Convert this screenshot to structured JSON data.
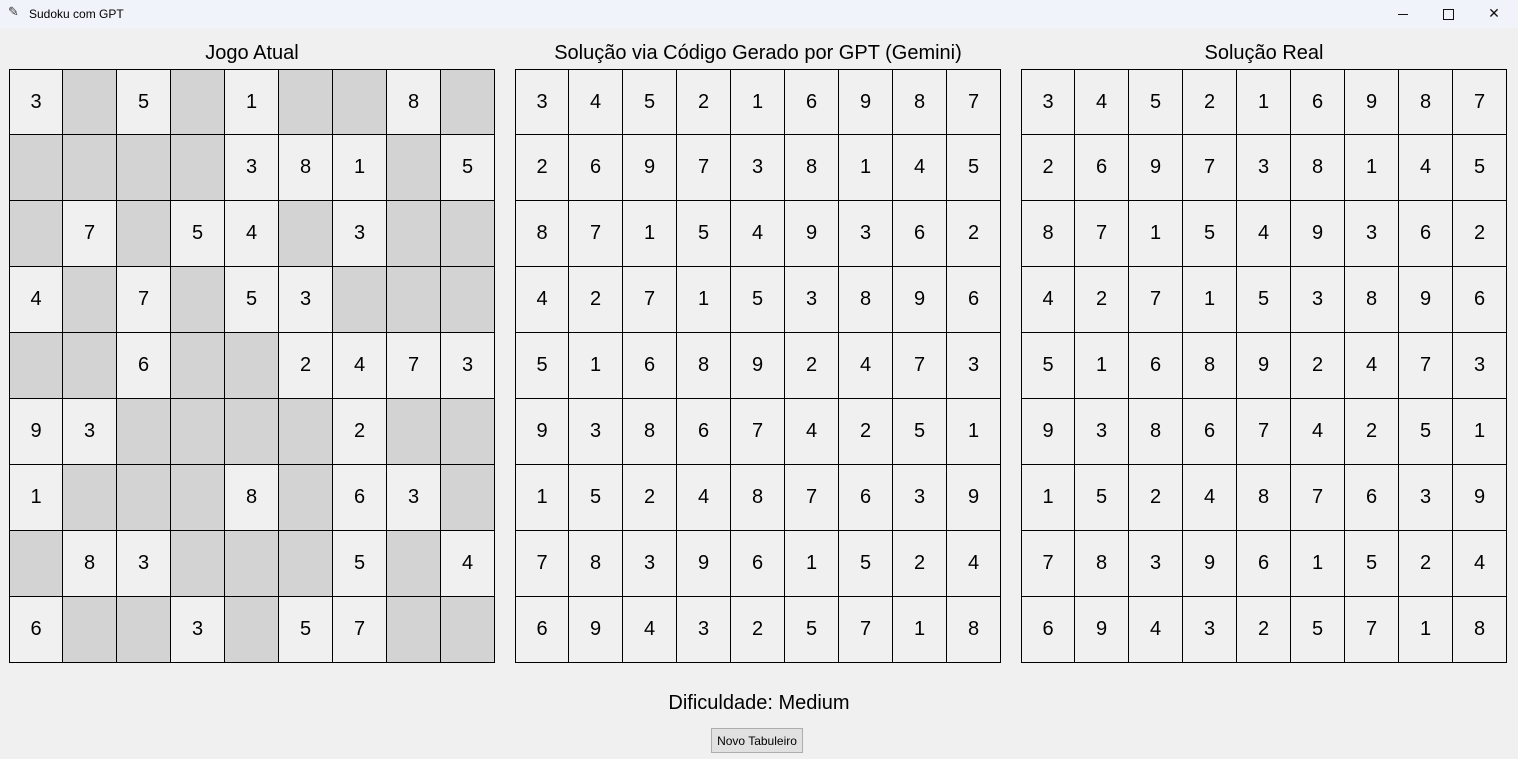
{
  "window": {
    "title": "Sudoku com GPT",
    "app_icon": "feather-icon",
    "minimize_glyph": "—",
    "maximize_glyph": "☐",
    "close_glyph": "✕"
  },
  "panels": [
    {
      "title": "Jogo Atual",
      "rows": [
        [
          "3",
          "",
          "5",
          "",
          "1",
          "",
          "",
          "8",
          ""
        ],
        [
          "",
          "",
          "",
          "",
          "3",
          "8",
          "1",
          "",
          "5"
        ],
        [
          "",
          "7",
          "",
          "5",
          "4",
          "",
          "3",
          "",
          ""
        ],
        [
          "4",
          "",
          "7",
          "",
          "5",
          "3",
          "",
          "",
          ""
        ],
        [
          "",
          "",
          "6",
          "",
          "",
          "2",
          "4",
          "7",
          "3"
        ],
        [
          "9",
          "3",
          "",
          "",
          "",
          "",
          "2",
          "",
          ""
        ],
        [
          "1",
          "",
          "",
          "",
          "8",
          "",
          "6",
          "3",
          ""
        ],
        [
          "",
          "8",
          "3",
          "",
          "",
          "",
          "5",
          "",
          "4"
        ],
        [
          "6",
          "",
          "",
          "3",
          "",
          "5",
          "7",
          "",
          ""
        ]
      ]
    },
    {
      "title": "Solução via Código Gerado por GPT (Gemini)",
      "rows": [
        [
          "3",
          "4",
          "5",
          "2",
          "1",
          "6",
          "9",
          "8",
          "7"
        ],
        [
          "2",
          "6",
          "9",
          "7",
          "3",
          "8",
          "1",
          "4",
          "5"
        ],
        [
          "8",
          "7",
          "1",
          "5",
          "4",
          "9",
          "3",
          "6",
          "2"
        ],
        [
          "4",
          "2",
          "7",
          "1",
          "5",
          "3",
          "8",
          "9",
          "6"
        ],
        [
          "5",
          "1",
          "6",
          "8",
          "9",
          "2",
          "4",
          "7",
          "3"
        ],
        [
          "9",
          "3",
          "8",
          "6",
          "7",
          "4",
          "2",
          "5",
          "1"
        ],
        [
          "1",
          "5",
          "2",
          "4",
          "8",
          "7",
          "6",
          "3",
          "9"
        ],
        [
          "7",
          "8",
          "3",
          "9",
          "6",
          "1",
          "5",
          "2",
          "4"
        ],
        [
          "6",
          "9",
          "4",
          "3",
          "2",
          "5",
          "7",
          "1",
          "8"
        ]
      ]
    },
    {
      "title": "Solução Real",
      "rows": [
        [
          "3",
          "4",
          "5",
          "2",
          "1",
          "6",
          "9",
          "8",
          "7"
        ],
        [
          "2",
          "6",
          "9",
          "7",
          "3",
          "8",
          "1",
          "4",
          "5"
        ],
        [
          "8",
          "7",
          "1",
          "5",
          "4",
          "9",
          "3",
          "6",
          "2"
        ],
        [
          "4",
          "2",
          "7",
          "1",
          "5",
          "3",
          "8",
          "9",
          "6"
        ],
        [
          "5",
          "1",
          "6",
          "8",
          "9",
          "2",
          "4",
          "7",
          "3"
        ],
        [
          "9",
          "3",
          "8",
          "6",
          "7",
          "4",
          "2",
          "5",
          "1"
        ],
        [
          "1",
          "5",
          "2",
          "4",
          "8",
          "7",
          "6",
          "3",
          "9"
        ],
        [
          "7",
          "8",
          "3",
          "9",
          "6",
          "1",
          "5",
          "2",
          "4"
        ],
        [
          "6",
          "9",
          "4",
          "3",
          "2",
          "5",
          "7",
          "1",
          "8"
        ]
      ]
    }
  ],
  "difficulty_label": "Dificuldade: Medium",
  "new_board_button": "Novo Tabuleiro",
  "colors": {
    "empty_cell": "#d3d3d3",
    "filled_cell": "#f0f0f0",
    "background": "#f0f0f0"
  }
}
